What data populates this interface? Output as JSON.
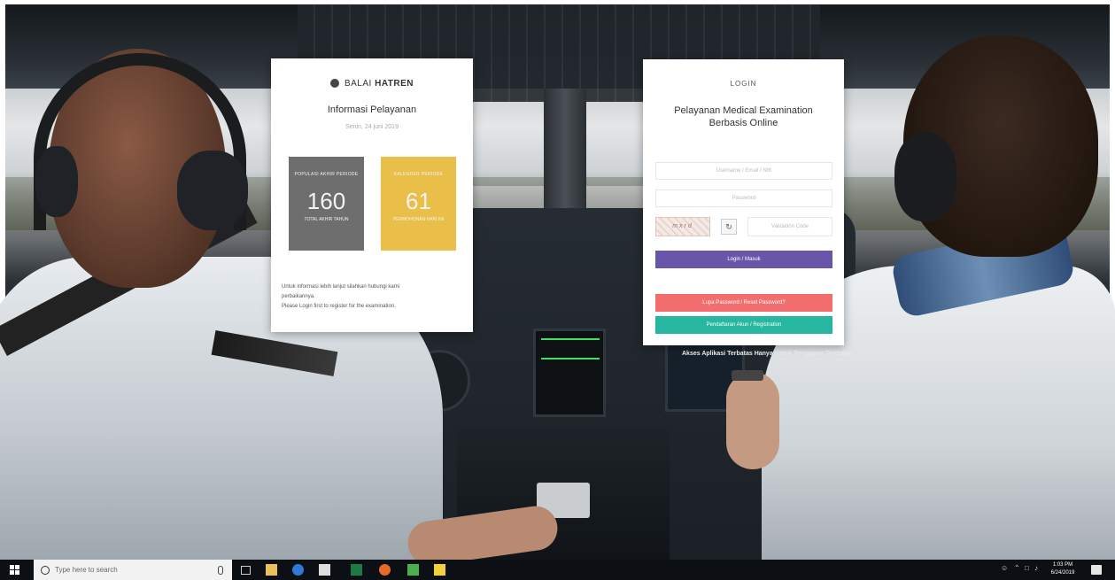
{
  "info_card": {
    "brand": "BALAI",
    "brand_bold": "HATREN",
    "title": "Informasi Pelayanan",
    "date": "Senin, 24 juni 2019",
    "stats": [
      {
        "label": "POPULASI AKHIR PERIODE",
        "value": "160",
        "sub": "TOTAL AKHIR TAHUN",
        "color": "#6e6e6e"
      },
      {
        "label": "KALENDER PERIODE",
        "value": "61",
        "sub": "PERMOHONAN HARI INI",
        "color": "#eabf49"
      }
    ],
    "note_lines": [
      "Untuk informasi lebih lanjut silahkan hubungi kami",
      "perbaikannya.",
      "Please Login first to register for the examination."
    ]
  },
  "login_card": {
    "title": "LOGIN",
    "subtitle_line1": "Pelayanan Medical Examination",
    "subtitle_line2": "Berbasis Online",
    "username_placeholder": "Username / Email / NIK",
    "password_placeholder": "Password",
    "captcha_text": "mxrd",
    "captcha_placeholder": "Validation Code",
    "login_button": "Login / Masuk",
    "forgot_button": "Lupa Password / Reset Password?",
    "register_button": "Pendaftaran Akun / Registration"
  },
  "overlay_text": "Akses Aplikasi Terbatas Hanya Untuk Pengguna Terdaftar",
  "taskbar": {
    "search_placeholder": "Type here to search",
    "time": "1:03 PM",
    "date": "6/24/2019"
  },
  "colors": {
    "login_button": "#6a56a8",
    "forgot_button": "#f26d6d",
    "register_button": "#27b7a1"
  }
}
